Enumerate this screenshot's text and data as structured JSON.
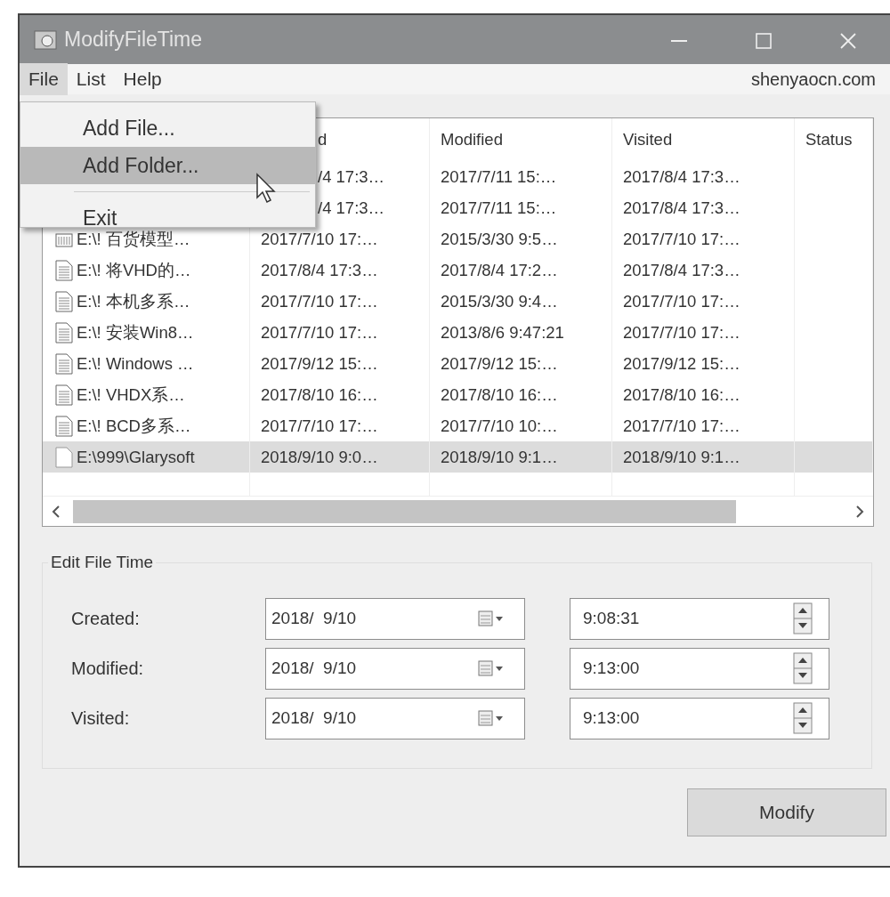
{
  "window": {
    "title": "ModifyFileTime"
  },
  "menu_bar": {
    "items": [
      {
        "label": "File",
        "selected": true
      },
      {
        "label": "List",
        "selected": false
      },
      {
        "label": "Help",
        "selected": false
      }
    ],
    "link": "shenyaocn.com"
  },
  "file_menu": {
    "items": [
      {
        "kind": "item",
        "label": "Add File...",
        "selected": false
      },
      {
        "kind": "item",
        "label": "Add Folder...",
        "selected": true
      },
      {
        "kind": "separator"
      },
      {
        "kind": "item",
        "label": "Exit",
        "selected": false
      }
    ]
  },
  "table": {
    "columns": [
      "d",
      "Modified",
      "Visited",
      "Status"
    ],
    "rows": [
      {
        "created": "/4 17:3…",
        "modified": "2017/7/11 15:…",
        "visited": "2017/8/4 17:3…",
        "selected": false
      },
      {
        "created": "/4 17:3…",
        "modified": "2017/7/11 15:…",
        "visited": "2017/8/4 17:3…",
        "selected": false
      },
      {
        "kind": "folder",
        "name": "E:\\! 百货模型…",
        "created": "2017/7/10 17:…",
        "modified": "2015/3/30 9:5…",
        "visited": "2017/7/10 17:…",
        "selected": false
      },
      {
        "kind": "file",
        "name": "E:\\! 将VHD的…",
        "created": "2017/8/4 17:3…",
        "modified": "2017/8/4 17:2…",
        "visited": "2017/8/4 17:3…",
        "selected": false
      },
      {
        "kind": "file",
        "name": "E:\\! 本机多系…",
        "created": "2017/7/10 17:…",
        "modified": "2015/3/30 9:4…",
        "visited": "2017/7/10 17:…",
        "selected": false
      },
      {
        "kind": "file",
        "name": "E:\\! 安装Win8…",
        "created": "2017/7/10 17:…",
        "modified": "2013/8/6 9:47:21",
        "visited": "2017/7/10 17:…",
        "selected": false
      },
      {
        "kind": "file",
        "name": "E:\\! Windows …",
        "created": "2017/9/12 15:…",
        "modified": "2017/9/12 15:…",
        "visited": "2017/9/12 15:…",
        "selected": false
      },
      {
        "kind": "file",
        "name": "E:\\! VHDX系…",
        "created": "2017/8/10 16:…",
        "modified": "2017/8/10 16:…",
        "visited": "2017/8/10 16:…",
        "selected": false
      },
      {
        "kind": "file",
        "name": "E:\\! BCD多系…",
        "created": "2017/7/10 17:…",
        "modified": "2017/7/10 10:…",
        "visited": "2017/7/10 17:…",
        "selected": false
      },
      {
        "kind": "blank",
        "name": "E:\\999\\Glarysoft",
        "created": "2018/9/10 9:0…",
        "modified": "2018/9/10 9:1…",
        "visited": "2018/9/10 9:1…",
        "selected": true
      }
    ]
  },
  "edit_file_time": {
    "title": "Edit File Time",
    "fields": [
      {
        "label": "Created:",
        "date": "2018/  9/10",
        "time": "9:08:31"
      },
      {
        "label": "Modified:",
        "date": "2018/  9/10",
        "time": "9:13:00"
      },
      {
        "label": "Visited:",
        "date": "2018/  9/10",
        "time": "9:13:00"
      }
    ]
  },
  "buttons": [
    "Modify"
  ]
}
